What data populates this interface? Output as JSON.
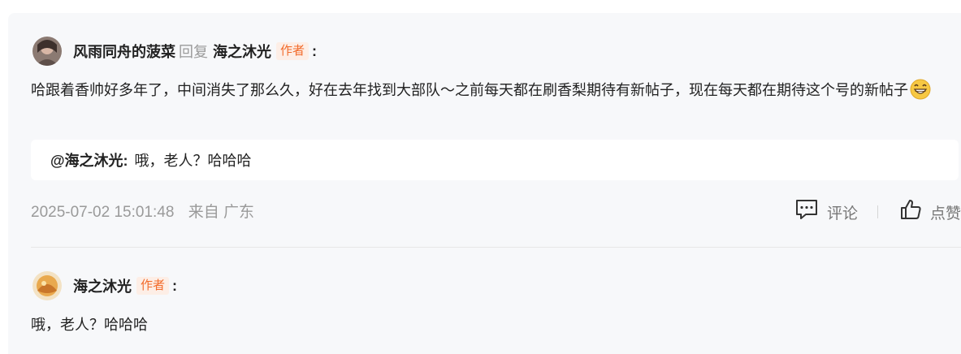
{
  "comment1": {
    "author": "风雨同舟的菠菜",
    "reply_word": "回复",
    "reply_to": "海之沐光",
    "badge": "作者",
    "colon": ":",
    "text": "哈跟着香帅好多年了，中间消失了那么久，好在去年找到大部队～之前每天都在刷香梨期待有新帖子，现在每天都在期待这个号的新帖子",
    "emoji": "grinning-face-icon",
    "quote": {
      "name": "@海之沐光:",
      "text": "哦，老人？哈哈哈"
    },
    "timestamp": "2025-07-02 15:01:48",
    "location": "来自 广东",
    "actions": {
      "comment_label": "评论",
      "like_label": "点赞"
    }
  },
  "comment2": {
    "author": "海之沐光",
    "badge": "作者",
    "colon": ":",
    "text": "哦，老人？哈哈哈"
  },
  "colors": {
    "accent": "#f26b2b",
    "badge_bg": "#fdeee6",
    "muted": "#9a9a9a"
  }
}
